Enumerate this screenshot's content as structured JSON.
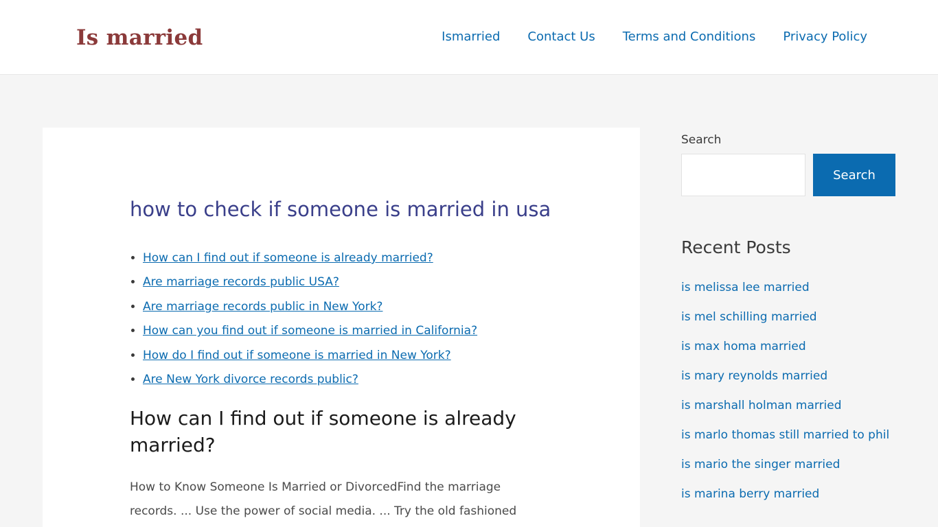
{
  "header": {
    "logo": "Is married",
    "nav": [
      "Ismarried",
      "Contact Us",
      "Terms and Conditions",
      "Privacy Policy"
    ]
  },
  "article": {
    "title": "how to check if someone is married in usa",
    "toc": [
      "How can I find out if someone is already married?",
      "Are marriage records public USA?",
      "Are marriage records public in New York?",
      "How can you find out if someone is married in California?",
      "How do I find out if someone is married in New York?",
      "Are New York divorce records public?"
    ],
    "section_heading": "How can I find out if someone is already married?",
    "body_text": "How to Know Someone Is Married or DivorcedFind the marriage records. ... Use the power of social media. ... Try the old fashioned"
  },
  "sidebar": {
    "search_label": "Search",
    "search_value": "",
    "search_button": "Search",
    "recent_title": "Recent Posts",
    "recent_posts": [
      "is melissa lee married",
      "is mel schilling married",
      "is max homa married",
      "is mary reynolds married",
      "is marshall holman married",
      "is marlo thomas still married to phil",
      "is mario the singer married",
      "is marina berry married"
    ]
  },
  "colors": {
    "logo": "#8b3a3a",
    "link": "#0b6bb0",
    "title": "#3a3f8a",
    "page_bg": "#f5f5f5"
  }
}
